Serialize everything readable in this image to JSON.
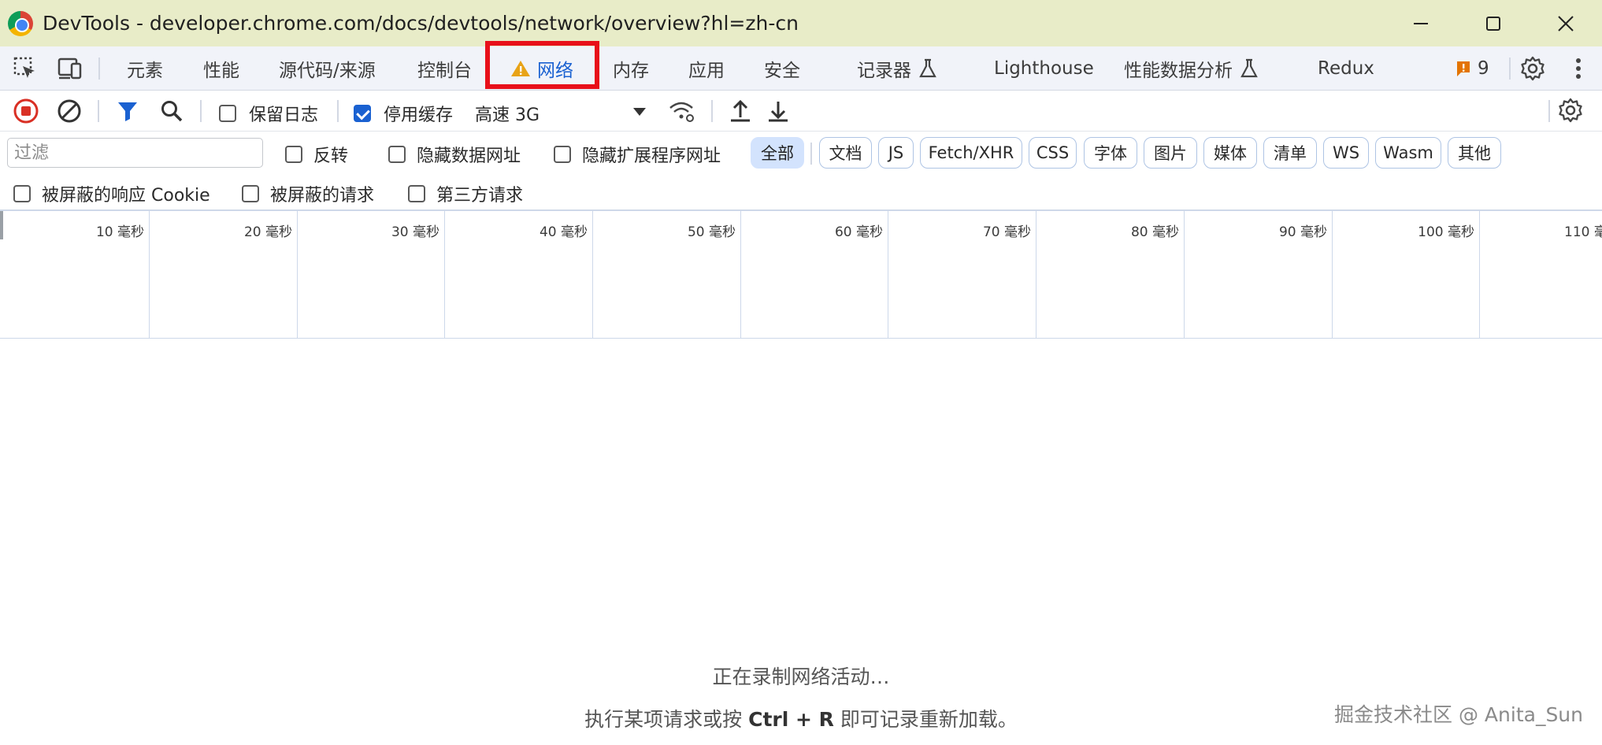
{
  "window": {
    "title": "DevTools - developer.chrome.com/docs/devtools/network/overview?hl=zh-cn",
    "minimize_icon": "minimize-icon",
    "maximize_icon": "maximize-icon",
    "close_icon": "close-icon"
  },
  "tabs": [
    {
      "label": "元素"
    },
    {
      "label": "性能"
    },
    {
      "label": "源代码/来源"
    },
    {
      "label": "控制台"
    },
    {
      "label": "网络",
      "active": true,
      "warning": true
    },
    {
      "label": "内存"
    },
    {
      "label": "应用"
    },
    {
      "label": "安全"
    },
    {
      "label": "记录器",
      "experimental": true
    },
    {
      "label": "Lighthouse"
    },
    {
      "label": "性能数据分析",
      "experimental": true
    },
    {
      "label": "Redux"
    }
  ],
  "issues_badge": {
    "count": "9"
  },
  "network_toolbar": {
    "preserve_log_label": "保留日志",
    "preserve_log_checked": false,
    "disable_cache_label": "停用缓存",
    "disable_cache_checked": true,
    "throttling_value": "高速 3G"
  },
  "filter": {
    "placeholder": "过滤",
    "invert_label": "反转",
    "hide_data_urls_label": "隐藏数据网址",
    "hide_extension_urls_label": "隐藏扩展程序网址",
    "chips": [
      "全部",
      "文档",
      "JS",
      "Fetch/XHR",
      "CSS",
      "字体",
      "图片",
      "媒体",
      "清单",
      "WS",
      "Wasm",
      "其他"
    ],
    "active_chip": "全部",
    "blocked_cookies_label": "被屏蔽的响应 Cookie",
    "blocked_requests_label": "被屏蔽的请求",
    "third_party_label": "第三方请求"
  },
  "timeline": {
    "ticks": [
      "10 毫秒",
      "20 毫秒",
      "30 毫秒",
      "40 毫秒",
      "50 毫秒",
      "60 毫秒",
      "70 毫秒",
      "80 毫秒",
      "90 毫秒",
      "100 毫秒",
      "110 毫"
    ]
  },
  "empty_state": {
    "recording_text": "正在录制网络活动…",
    "hint_before": "执行某项请求或按 ",
    "hint_keys": "Ctrl + R",
    "hint_after": " 即可记录重新加载。"
  },
  "watermark": "掘金技术社区 @ Anita_Sun",
  "colors": {
    "title_bar_bg": "#e8ecc8",
    "tab_bar_bg": "#f1f3f9",
    "active_tab": "#1a61d1",
    "highlight_border": "#e8101a",
    "record_red": "#d93025"
  }
}
